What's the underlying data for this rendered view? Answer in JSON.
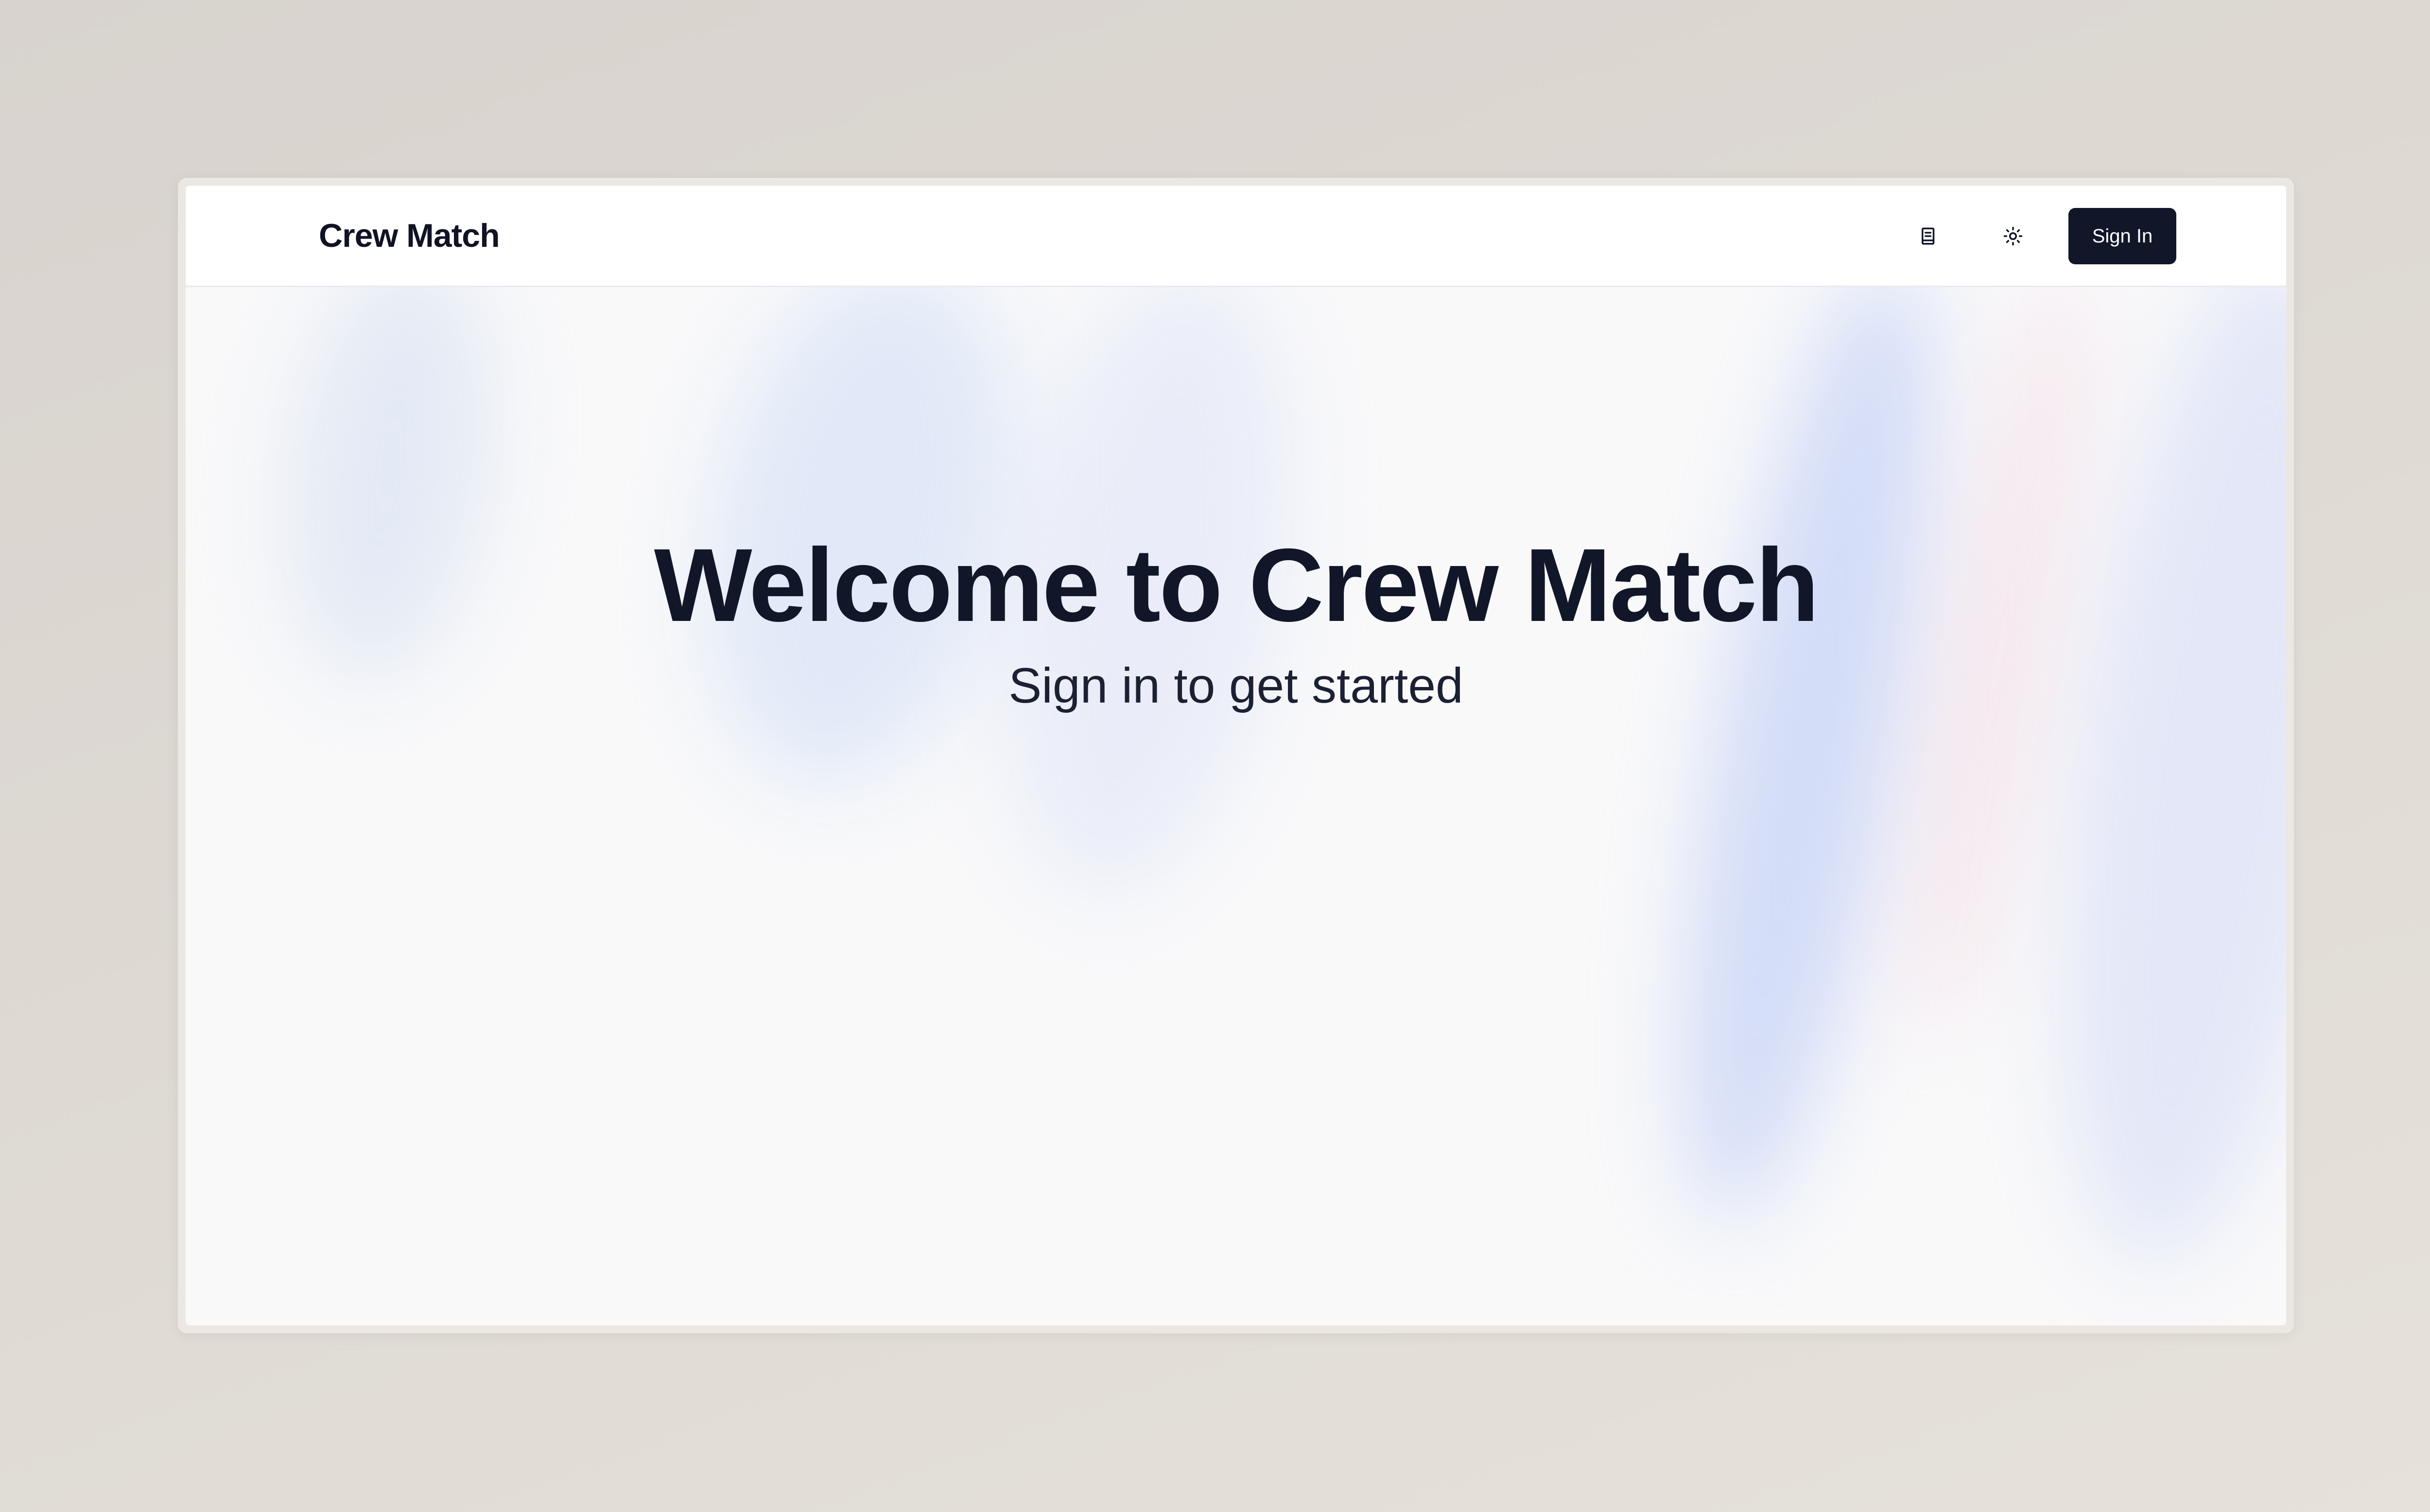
{
  "app": {
    "brand": "Crew Match"
  },
  "nav": {
    "docs_icon": "book-icon",
    "theme_icon": "sun-icon",
    "signin_label": "Sign In"
  },
  "hero": {
    "title": "Welcome to Crew Match",
    "subtitle": "Sign in to get started"
  },
  "colors": {
    "primary_button": "#111729",
    "text": "#111729",
    "background": "#f9f9fa",
    "navbar": "#ffffff"
  }
}
